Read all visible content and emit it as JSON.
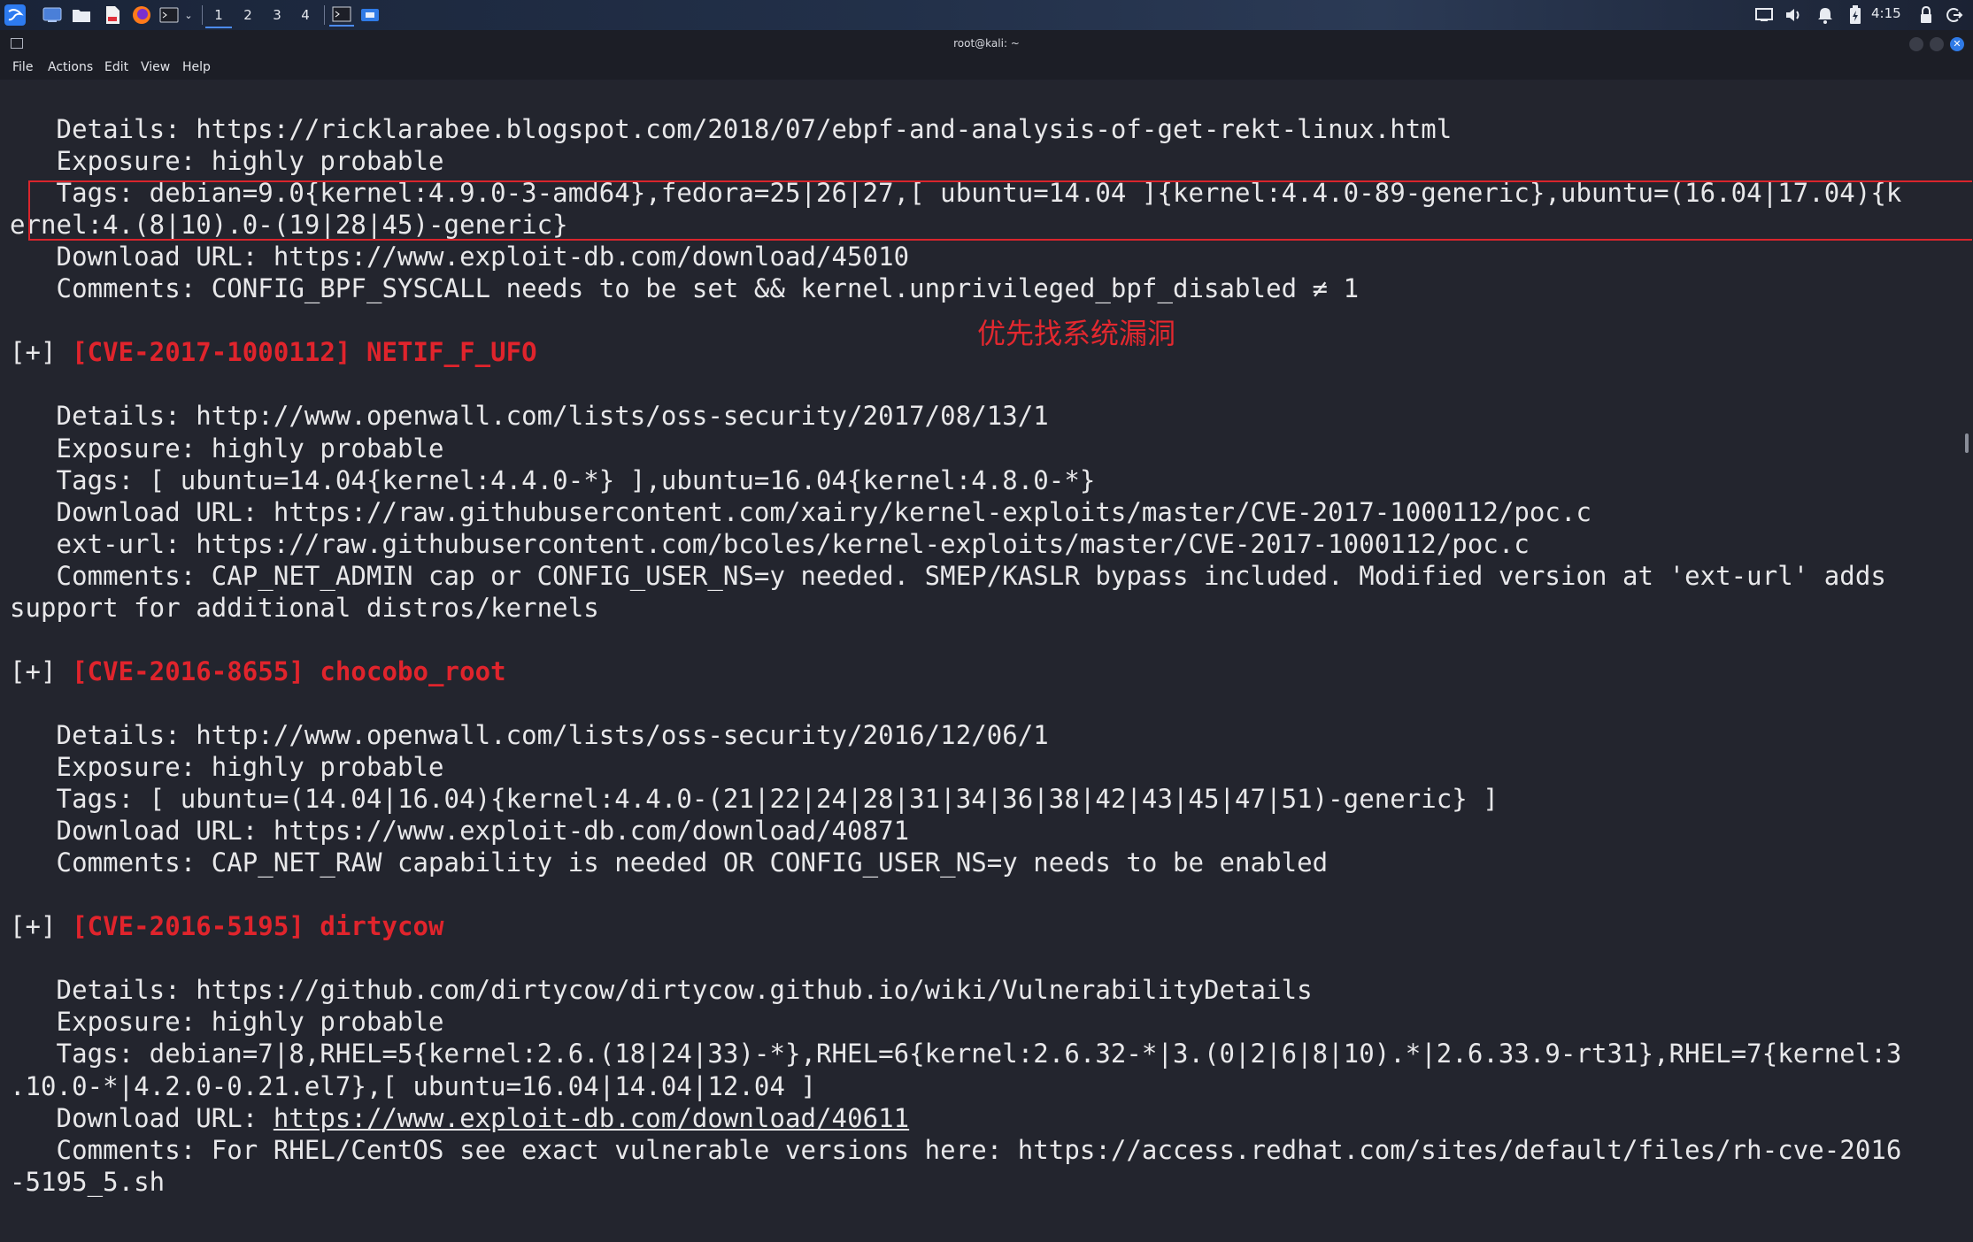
{
  "panel": {
    "workspaces": [
      "1",
      "2",
      "3",
      "4"
    ],
    "active_workspace": "1",
    "clock": "4:15",
    "icons": [
      "kali-menu-icon",
      "show-desktop-icon",
      "file-manager-icon",
      "text-editor-icon",
      "firefox-icon",
      "terminal-icon",
      "dropdown-icon",
      "terminal-window-icon",
      "app-window-icon",
      "display-icon",
      "volume-icon",
      "notification-bell-icon",
      "battery-icon",
      "lock-icon",
      "logout-icon"
    ]
  },
  "window": {
    "title": "root@kali: ~",
    "menu": [
      "File",
      "Actions",
      "Edit",
      "View",
      "Help"
    ]
  },
  "annotation": {
    "text": "优先找系统漏洞",
    "color": "#e3282f"
  },
  "terminal": {
    "lines": [
      {
        "text": "   Details: https://ricklarabee.blogspot.com/2018/07/ebpf-and-analysis-of-get-rekt-linux.html"
      },
      {
        "text": "   Exposure: highly probable"
      },
      {
        "text": "   Tags: debian=9.0{kernel:4.9.0-3-amd64},fedora=25|26|27,[ ubuntu=14.04 ]{kernel:4.4.0-89-generic},ubuntu=(16.04|17.04){k"
      },
      {
        "text": "ernel:4.(8|10).0-(19|28|45)-generic}"
      },
      {
        "text": "   Download URL: https://www.exploit-db.com/download/45010"
      },
      {
        "text": "   Comments: CONFIG_BPF_SYSCALL needs to be set && kernel.unprivileged_bpf_disabled ≠ 1"
      },
      {
        "text": ""
      },
      {
        "prefix": "[+] ",
        "cve": "[CVE-2017-1000112] NETIF_F_UFO"
      },
      {
        "text": ""
      },
      {
        "text": "   Details: http://www.openwall.com/lists/oss-security/2017/08/13/1"
      },
      {
        "text": "   Exposure: highly probable"
      },
      {
        "text": "   Tags: [ ubuntu=14.04{kernel:4.4.0-*} ],ubuntu=16.04{kernel:4.8.0-*}"
      },
      {
        "text": "   Download URL: https://raw.githubusercontent.com/xairy/kernel-exploits/master/CVE-2017-1000112/poc.c"
      },
      {
        "text": "   ext-url: https://raw.githubusercontent.com/bcoles/kernel-exploits/master/CVE-2017-1000112/poc.c"
      },
      {
        "text": "   Comments: CAP_NET_ADMIN cap or CONFIG_USER_NS=y needed. SMEP/KASLR bypass included. Modified version at 'ext-url' adds"
      },
      {
        "text": "support for additional distros/kernels"
      },
      {
        "text": ""
      },
      {
        "prefix": "[+] ",
        "cve": "[CVE-2016-8655] chocobo_root"
      },
      {
        "text": ""
      },
      {
        "text": "   Details: http://www.openwall.com/lists/oss-security/2016/12/06/1"
      },
      {
        "text": "   Exposure: highly probable"
      },
      {
        "text": "   Tags: [ ubuntu=(14.04|16.04){kernel:4.4.0-(21|22|24|28|31|34|36|38|42|43|45|47|51)-generic} ]"
      },
      {
        "text": "   Download URL: https://www.exploit-db.com/download/40871"
      },
      {
        "text": "   Comments: CAP_NET_RAW capability is needed OR CONFIG_USER_NS=y needs to be enabled"
      },
      {
        "text": ""
      },
      {
        "prefix": "[+] ",
        "cve": "[CVE-2016-5195] dirtycow"
      },
      {
        "text": ""
      },
      {
        "text": "   Details: https://github.com/dirtycow/dirtycow.github.io/wiki/VulnerabilityDetails"
      },
      {
        "text": "   Exposure: highly probable"
      },
      {
        "text": "   Tags: debian=7|8,RHEL=5{kernel:2.6.(18|24|33)-*},RHEL=6{kernel:2.6.32-*|3.(0|2|6|8|10).*|2.6.33.9-rt31},RHEL=7{kernel:3"
      },
      {
        "text": ".10.0-*|4.2.0-0.21.el7},[ ubuntu=16.04|14.04|12.04 ]"
      },
      {
        "prefix": "   Download URL: ",
        "link": "https://www.exploit-db.com/download/40611"
      },
      {
        "text": "   Comments: For RHEL/CentOS see exact vulnerable versions here: https://access.redhat.com/sites/default/files/rh-cve-2016"
      },
      {
        "text": "-5195_5.sh"
      }
    ]
  }
}
